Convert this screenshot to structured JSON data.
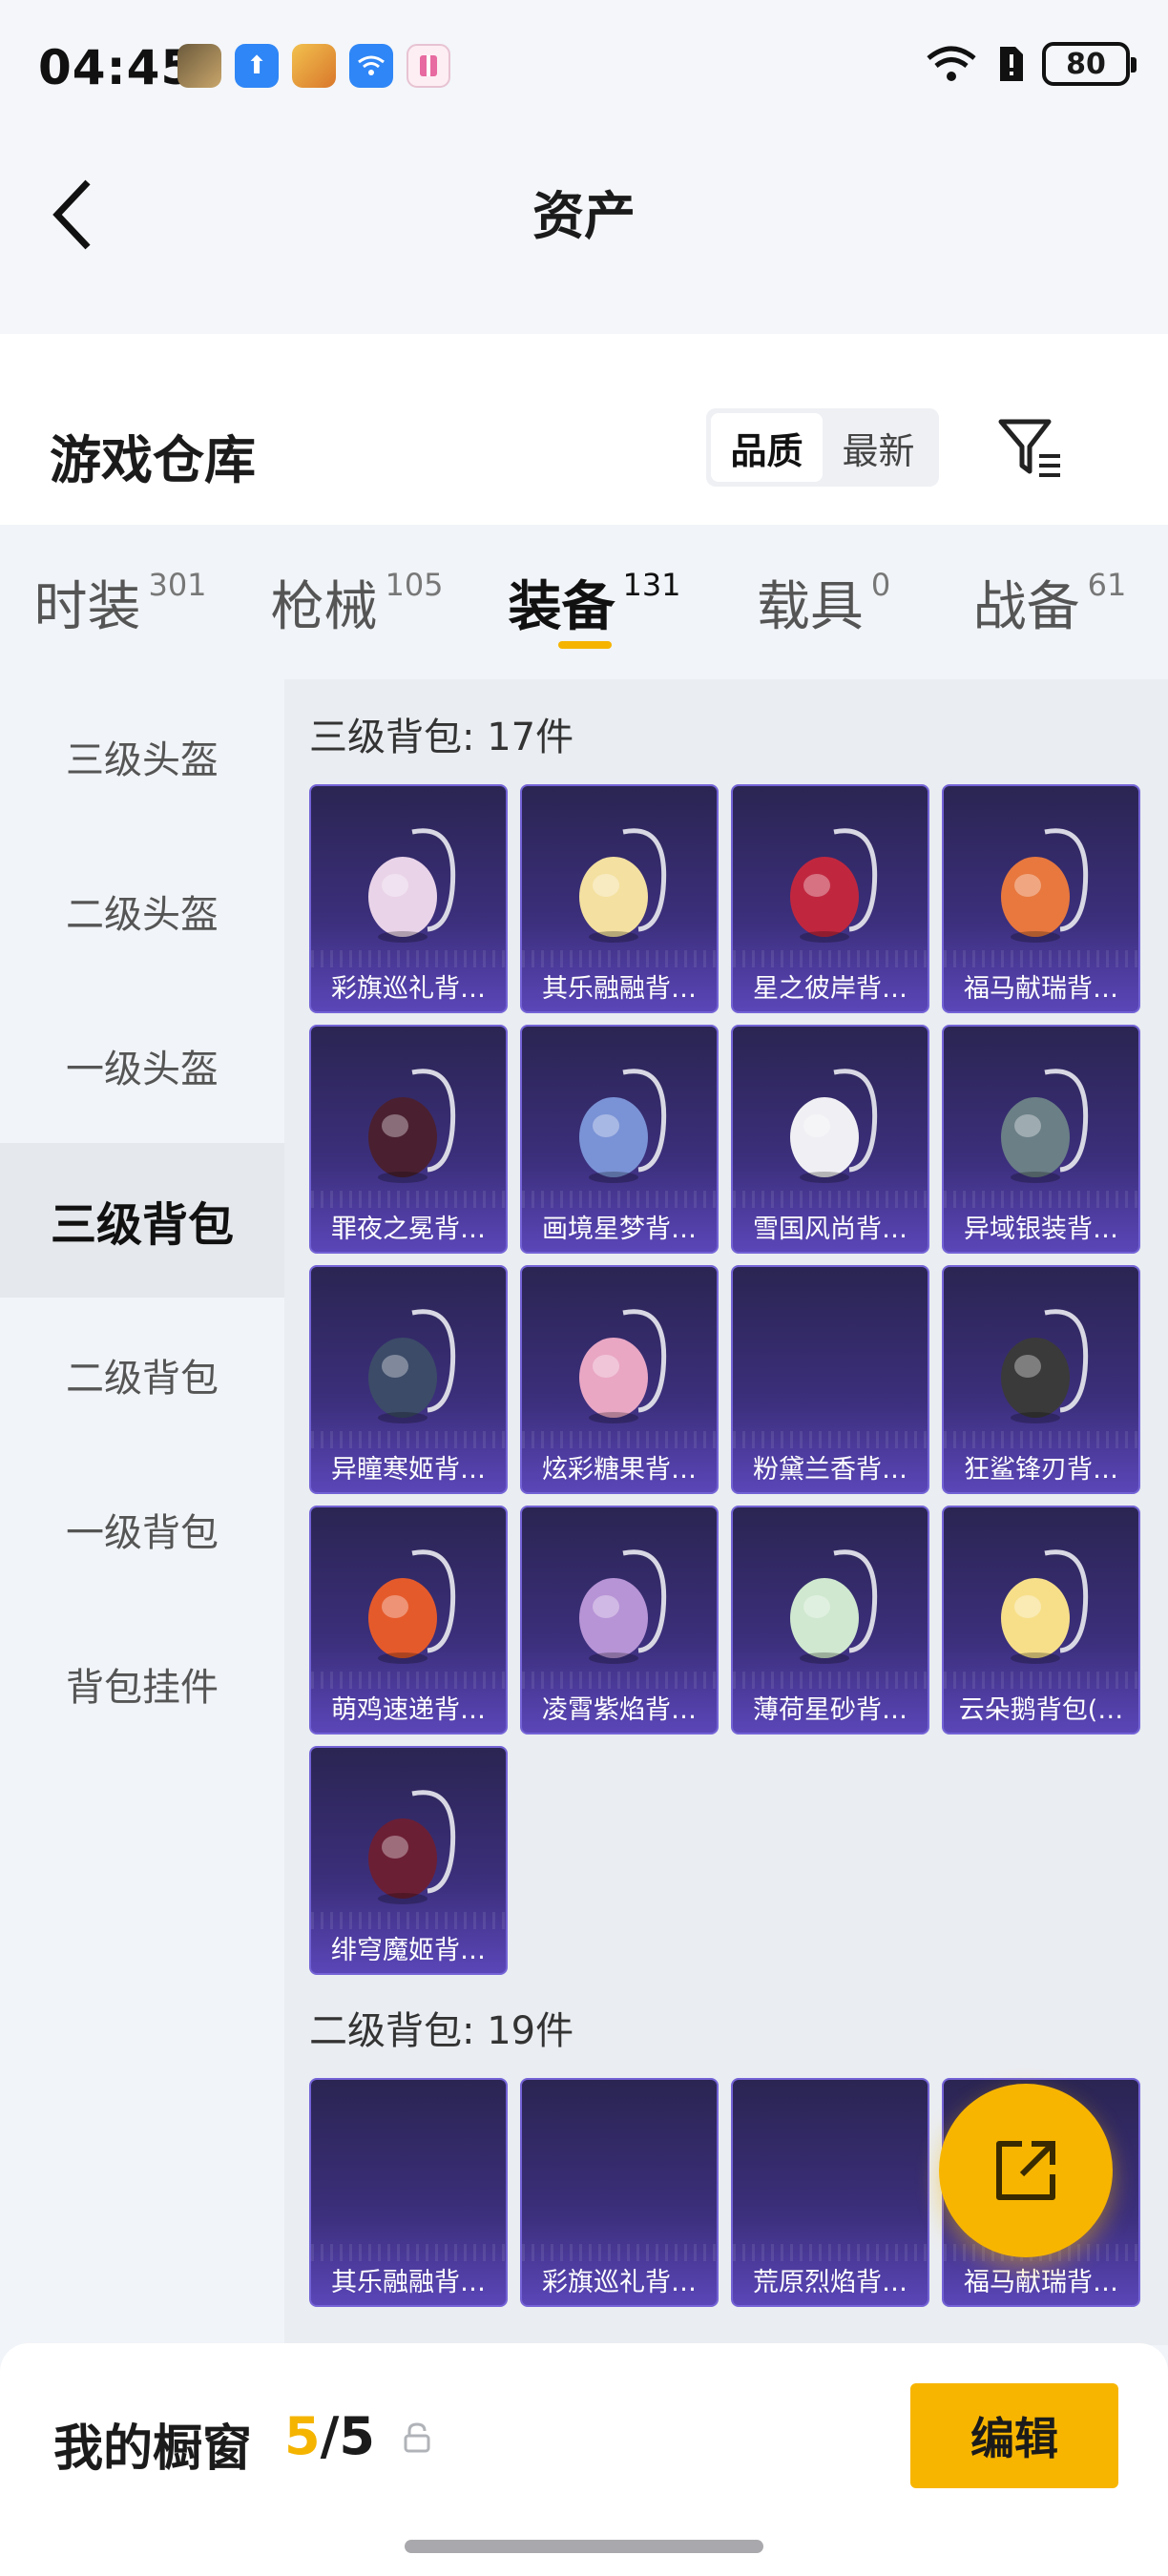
{
  "status_bar": {
    "time": "04:45",
    "battery": "80"
  },
  "header": {
    "title": "资产"
  },
  "warehouse": {
    "title": "游戏仓库",
    "sort_options": [
      "品质",
      "最新"
    ]
  },
  "tabs": [
    {
      "label": "时装",
      "count": "301"
    },
    {
      "label": "枪械",
      "count": "105"
    },
    {
      "label": "装备",
      "count": "131",
      "active": true
    },
    {
      "label": "载具",
      "count": "0"
    },
    {
      "label": "战备",
      "count": "61"
    }
  ],
  "sidebar": {
    "items": [
      "三级头盔",
      "二级头盔",
      "一级头盔",
      "三级背包",
      "二级背包",
      "一级背包",
      "背包挂件"
    ],
    "active": "三级背包"
  },
  "sections": [
    {
      "title": "三级背包: 17件",
      "items": [
        "彩旗巡礼背…",
        "其乐融融背…",
        "星之彼岸背…",
        "福马献瑞背…",
        "罪夜之冕背…",
        "画境星梦背…",
        "雪国风尚背…",
        "异域银装背…",
        "异瞳寒姬背…",
        "炫彩糖果背…",
        "粉黛兰香背…",
        "狂鲨锋刃背…",
        "萌鸡速递背…",
        "凌霄紫焰背…",
        "薄荷星砂背…",
        "云朵鹅背包(…",
        "绯穹魔姬背…"
      ]
    },
    {
      "title": "二级背包: 19件",
      "items": [
        "其乐融融背…",
        "彩旗巡礼背…",
        "荒原烈焰背…",
        "福马献瑞背…"
      ]
    }
  ],
  "bottom": {
    "label": "我的橱窗",
    "current": "5",
    "separator": "/",
    "total": "5",
    "edit_label": "编辑"
  },
  "colors": {
    "accent": "#f7b500",
    "card_bg": "#3c2f7c",
    "card_border": "#7363d6"
  }
}
